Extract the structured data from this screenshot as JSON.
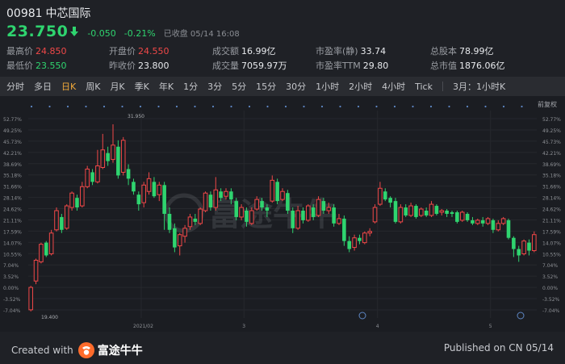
{
  "header": {
    "code": "00981",
    "name": "中芯国际",
    "price": "23.750",
    "change": "-0.050",
    "change_pct": "-0.21%",
    "status": "已收盘 05/14 16:08"
  },
  "stats": [
    {
      "label": "最高价",
      "value": "24.850",
      "tone": "red"
    },
    {
      "label": "开盘价",
      "value": "24.550",
      "tone": "red"
    },
    {
      "label": "成交额",
      "value": "16.99亿",
      "tone": "normal"
    },
    {
      "label": "市盈率(静)",
      "value": "33.74",
      "tone": "normal"
    },
    {
      "label": "总股本",
      "value": "78.99亿",
      "tone": "normal"
    },
    {
      "label": "最低价",
      "value": "23.550",
      "tone": "green"
    },
    {
      "label": "昨收价",
      "value": "23.800",
      "tone": "normal"
    },
    {
      "label": "成交量",
      "value": "7059.97万",
      "tone": "normal"
    },
    {
      "label": "市盈率TTM",
      "value": "29.80",
      "tone": "normal"
    },
    {
      "label": "总市值",
      "value": "1876.06亿",
      "tone": "normal"
    }
  ],
  "tabs": [
    "分时",
    "多日",
    "日K",
    "周K",
    "月K",
    "季K",
    "年K",
    "1分",
    "3分",
    "5分",
    "15分",
    "30分",
    "1小时",
    "2小时",
    "4小时",
    "Tick",
    "3月：1小时K"
  ],
  "active_tab": "日K",
  "chart_label": "前复权",
  "footer": {
    "created_with": "Created with",
    "brand": "富途牛牛",
    "published": "Published on CN 05/14"
  },
  "watermark": "富途牛牛",
  "colors": {
    "up": "#f04848",
    "down": "#2fd46f",
    "accent": "#f0a93a"
  },
  "chart_data": {
    "type": "candlestick",
    "y_ticks": [
      "52.77%",
      "49.25%",
      "45.73%",
      "42.21%",
      "38.69%",
      "35.18%",
      "31.66%",
      "28.14%",
      "24.62%",
      "21.11%",
      "17.59%",
      "14.07%",
      "10.55%",
      "7.04%",
      "3.52%",
      "0.00%",
      "-3.52%",
      "-7.04%"
    ],
    "ylim": [
      -7.04,
      52.77
    ],
    "x_ticks": [
      "2021/02",
      "3",
      "4",
      "5"
    ],
    "annotations": {
      "max": "31.950",
      "min": "19.400"
    },
    "candles": [
      {
        "o": -7.0,
        "c": 0.0,
        "h": 0.5,
        "l": -7.5
      },
      {
        "o": 2.0,
        "c": 8.5,
        "h": 9.0,
        "l": 1.0
      },
      {
        "o": 8.0,
        "c": 13.5,
        "h": 14.0,
        "l": 7.5
      },
      {
        "o": 14.0,
        "c": 10.0,
        "h": 14.5,
        "l": 9.5
      },
      {
        "o": 10.5,
        "c": 17.0,
        "h": 18.0,
        "l": 10.0
      },
      {
        "o": 18.0,
        "c": 24.0,
        "h": 25.0,
        "l": 17.5
      },
      {
        "o": 22.0,
        "c": 18.0,
        "h": 23.0,
        "l": 17.0
      },
      {
        "o": 18.5,
        "c": 25.5,
        "h": 26.0,
        "l": 18.0
      },
      {
        "o": 25.0,
        "c": 29.5,
        "h": 30.0,
        "l": 24.0
      },
      {
        "o": 28.0,
        "c": 25.0,
        "h": 29.0,
        "l": 24.0
      },
      {
        "o": 25.5,
        "c": 31.5,
        "h": 33.0,
        "l": 25.0
      },
      {
        "o": 31.5,
        "c": 37.0,
        "h": 38.0,
        "l": 31.0
      },
      {
        "o": 36.0,
        "c": 33.0,
        "h": 37.0,
        "l": 32.0
      },
      {
        "o": 33.0,
        "c": 38.0,
        "h": 43.0,
        "l": 32.5
      },
      {
        "o": 37.5,
        "c": 43.0,
        "h": 48.0,
        "l": 37.0
      },
      {
        "o": 42.0,
        "c": 39.5,
        "h": 44.0,
        "l": 38.0
      },
      {
        "o": 40.0,
        "c": 44.5,
        "h": 51.0,
        "l": 39.0
      },
      {
        "o": 44.0,
        "c": 35.0,
        "h": 46.0,
        "l": 34.0
      },
      {
        "o": 36.0,
        "c": 46.0,
        "h": 47.0,
        "l": 35.0
      },
      {
        "o": 37.0,
        "c": 34.0,
        "h": 38.5,
        "l": 32.0
      },
      {
        "o": 33.0,
        "c": 30.0,
        "h": 34.0,
        "l": 29.0
      },
      {
        "o": 29.0,
        "c": 26.0,
        "h": 30.0,
        "l": 24.0
      },
      {
        "o": 26.5,
        "c": 32.0,
        "h": 33.0,
        "l": 25.0
      },
      {
        "o": 30.0,
        "c": 34.0,
        "h": 36.0,
        "l": 29.0
      },
      {
        "o": 33.0,
        "c": 28.5,
        "h": 34.5,
        "l": 28.0
      },
      {
        "o": 29.0,
        "c": 32.0,
        "h": 33.0,
        "l": 27.0
      },
      {
        "o": 32.0,
        "c": 23.0,
        "h": 33.0,
        "l": 18.0
      },
      {
        "o": 23.0,
        "c": 18.0,
        "h": 25.0,
        "l": 17.0
      },
      {
        "o": 18.5,
        "c": 12.5,
        "h": 20.0,
        "l": 11.0
      },
      {
        "o": 13.0,
        "c": 16.5,
        "h": 17.0,
        "l": 10.0
      },
      {
        "o": 16.0,
        "c": 18.5,
        "h": 19.5,
        "l": 14.0
      },
      {
        "o": 19.0,
        "c": 22.0,
        "h": 23.0,
        "l": 18.0
      },
      {
        "o": 21.5,
        "c": 20.5,
        "h": 23.0,
        "l": 19.5
      },
      {
        "o": 20.0,
        "c": 24.5,
        "h": 25.0,
        "l": 19.5
      },
      {
        "o": 24.0,
        "c": 29.5,
        "h": 30.0,
        "l": 23.5
      },
      {
        "o": 29.0,
        "c": 25.0,
        "h": 30.0,
        "l": 24.0
      },
      {
        "o": 25.0,
        "c": 30.5,
        "h": 34.5,
        "l": 24.0
      },
      {
        "o": 30.0,
        "c": 28.0,
        "h": 31.0,
        "l": 27.0
      },
      {
        "o": 28.5,
        "c": 30.0,
        "h": 31.0,
        "l": 27.5
      },
      {
        "o": 30.0,
        "c": 27.5,
        "h": 31.0,
        "l": 26.0
      },
      {
        "o": 27.0,
        "c": 22.0,
        "h": 28.0,
        "l": 21.0
      },
      {
        "o": 22.0,
        "c": 25.0,
        "h": 26.0,
        "l": 21.0
      },
      {
        "o": 24.0,
        "c": 20.5,
        "h": 25.0,
        "l": 19.0
      },
      {
        "o": 20.0,
        "c": 24.0,
        "h": 25.0,
        "l": 19.5
      },
      {
        "o": 24.5,
        "c": 27.5,
        "h": 28.5,
        "l": 24.0
      },
      {
        "o": 27.0,
        "c": 25.0,
        "h": 28.0,
        "l": 24.0
      },
      {
        "o": 25.0,
        "c": 24.0,
        "h": 26.0,
        "l": 22.0
      },
      {
        "o": 27.0,
        "c": 33.5,
        "h": 35.0,
        "l": 26.5
      },
      {
        "o": 33.0,
        "c": 27.0,
        "h": 34.0,
        "l": 26.0
      },
      {
        "o": 27.5,
        "c": 30.0,
        "h": 31.0,
        "l": 27.0
      },
      {
        "o": 29.5,
        "c": 24.0,
        "h": 30.5,
        "l": 23.0
      },
      {
        "o": 24.0,
        "c": 18.5,
        "h": 25.0,
        "l": 17.0
      },
      {
        "o": 18.5,
        "c": 24.0,
        "h": 25.5,
        "l": 18.0
      },
      {
        "o": 24.0,
        "c": 21.0,
        "h": 25.0,
        "l": 20.0
      },
      {
        "o": 21.0,
        "c": 25.5,
        "h": 26.0,
        "l": 20.5
      },
      {
        "o": 25.0,
        "c": 22.0,
        "h": 26.0,
        "l": 21.0
      },
      {
        "o": 22.5,
        "c": 27.5,
        "h": 28.5,
        "l": 22.0
      },
      {
        "o": 27.0,
        "c": 24.0,
        "h": 28.0,
        "l": 23.0
      },
      {
        "o": 24.0,
        "c": 25.0,
        "h": 26.5,
        "l": 23.0
      },
      {
        "o": 25.0,
        "c": 20.0,
        "h": 26.0,
        "l": 19.0
      },
      {
        "o": 20.0,
        "c": 21.5,
        "h": 23.0,
        "l": 19.5
      },
      {
        "o": 21.5,
        "c": 14.5,
        "h": 22.5,
        "l": 13.0
      },
      {
        "o": 14.5,
        "c": 12.0,
        "h": 16.0,
        "l": 11.0
      },
      {
        "o": 12.5,
        "c": 15.5,
        "h": 16.5,
        "l": 11.5
      },
      {
        "o": 15.5,
        "c": 14.5,
        "h": 16.5,
        "l": 13.5
      },
      {
        "o": 14.0,
        "c": 17.0,
        "h": 17.5,
        "l": 13.5
      },
      {
        "o": 17.0,
        "c": 17.5,
        "h": 18.5,
        "l": 16.0
      },
      {
        "o": 20.5,
        "c": 25.0,
        "h": 26.0,
        "l": 20.0
      },
      {
        "o": 26.0,
        "c": 31.0,
        "h": 33.0,
        "l": 25.5
      },
      {
        "o": 30.0,
        "c": 27.5,
        "h": 31.0,
        "l": 27.0
      },
      {
        "o": 28.0,
        "c": 26.5,
        "h": 28.5,
        "l": 25.0
      },
      {
        "o": 27.0,
        "c": 20.5,
        "h": 28.0,
        "l": 20.0
      },
      {
        "o": 20.5,
        "c": 25.0,
        "h": 26.0,
        "l": 20.0
      },
      {
        "o": 25.0,
        "c": 22.5,
        "h": 26.0,
        "l": 22.0
      },
      {
        "o": 22.5,
        "c": 25.5,
        "h": 26.5,
        "l": 22.0
      },
      {
        "o": 25.5,
        "c": 22.0,
        "h": 26.0,
        "l": 21.5
      },
      {
        "o": 22.5,
        "c": 24.5,
        "h": 25.0,
        "l": 22.0
      },
      {
        "o": 24.0,
        "c": 22.5,
        "h": 25.0,
        "l": 22.0
      },
      {
        "o": 22.5,
        "c": 26.0,
        "h": 27.0,
        "l": 22.0
      },
      {
        "o": 25.5,
        "c": 23.0,
        "h": 26.0,
        "l": 22.5
      },
      {
        "o": 23.5,
        "c": 24.0,
        "h": 24.5,
        "l": 22.5
      },
      {
        "o": 24.0,
        "c": 23.0,
        "h": 24.5,
        "l": 22.0
      },
      {
        "o": 23.5,
        "c": 23.0,
        "h": 24.0,
        "l": 22.0
      },
      {
        "o": 23.5,
        "c": 20.5,
        "h": 24.0,
        "l": 20.0
      },
      {
        "o": 21.0,
        "c": 23.5,
        "h": 24.0,
        "l": 20.5
      },
      {
        "o": 23.0,
        "c": 21.0,
        "h": 23.5,
        "l": 20.5
      },
      {
        "o": 21.0,
        "c": 20.0,
        "h": 22.0,
        "l": 19.5
      },
      {
        "o": 20.0,
        "c": 21.0,
        "h": 21.5,
        "l": 19.5
      },
      {
        "o": 21.0,
        "c": 20.0,
        "h": 22.0,
        "l": 19.0
      },
      {
        "o": 20.0,
        "c": 21.5,
        "h": 22.0,
        "l": 19.5
      },
      {
        "o": 21.0,
        "c": 18.0,
        "h": 21.5,
        "l": 17.0
      },
      {
        "o": 18.0,
        "c": 20.0,
        "h": 21.0,
        "l": 17.5
      },
      {
        "o": 20.0,
        "c": 21.5,
        "h": 22.0,
        "l": 19.5
      },
      {
        "o": 21.0,
        "c": 15.5,
        "h": 21.5,
        "l": 15.0
      },
      {
        "o": 15.5,
        "c": 12.0,
        "h": 16.0,
        "l": 9.5
      },
      {
        "o": 12.0,
        "c": 10.0,
        "h": 13.0,
        "l": 8.0
      },
      {
        "o": 10.5,
        "c": 14.5,
        "h": 15.0,
        "l": 10.0
      },
      {
        "o": 14.0,
        "c": 11.5,
        "h": 15.0,
        "l": 10.0
      },
      {
        "o": 11.5,
        "c": 16.5,
        "h": 17.5,
        "l": 11.0
      }
    ]
  }
}
